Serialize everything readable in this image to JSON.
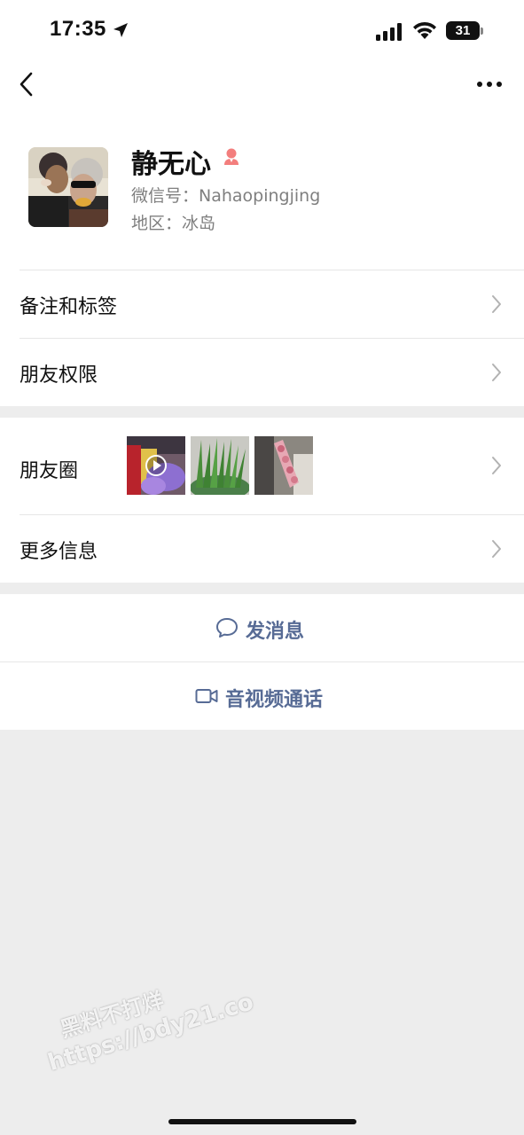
{
  "status_bar": {
    "time": "17:35",
    "battery": "31",
    "icons": [
      "location-arrow-icon",
      "cellular-signal-icon",
      "wifi-icon",
      "battery-icon"
    ]
  },
  "nav": {
    "back_icon": "chevron-left-icon",
    "more_icon": "more-dots-icon"
  },
  "profile": {
    "name": "静无心",
    "gender_icon": "female-icon",
    "gender_color": "#f37e7d",
    "wechat_id": "微信号：Nahaopingjing",
    "region": "地区：冰岛"
  },
  "menu": {
    "remark_tags": "备注和标签",
    "friend_permissions": "朋友权限",
    "moments": "朋友圈",
    "more_info": "更多信息"
  },
  "actions": {
    "send_message": "发消息",
    "video_call": "音视频通话",
    "accent_color": "#576b95"
  },
  "watermark": {
    "line1": "黑料不打烊",
    "line2": "https://bdy21.co"
  }
}
